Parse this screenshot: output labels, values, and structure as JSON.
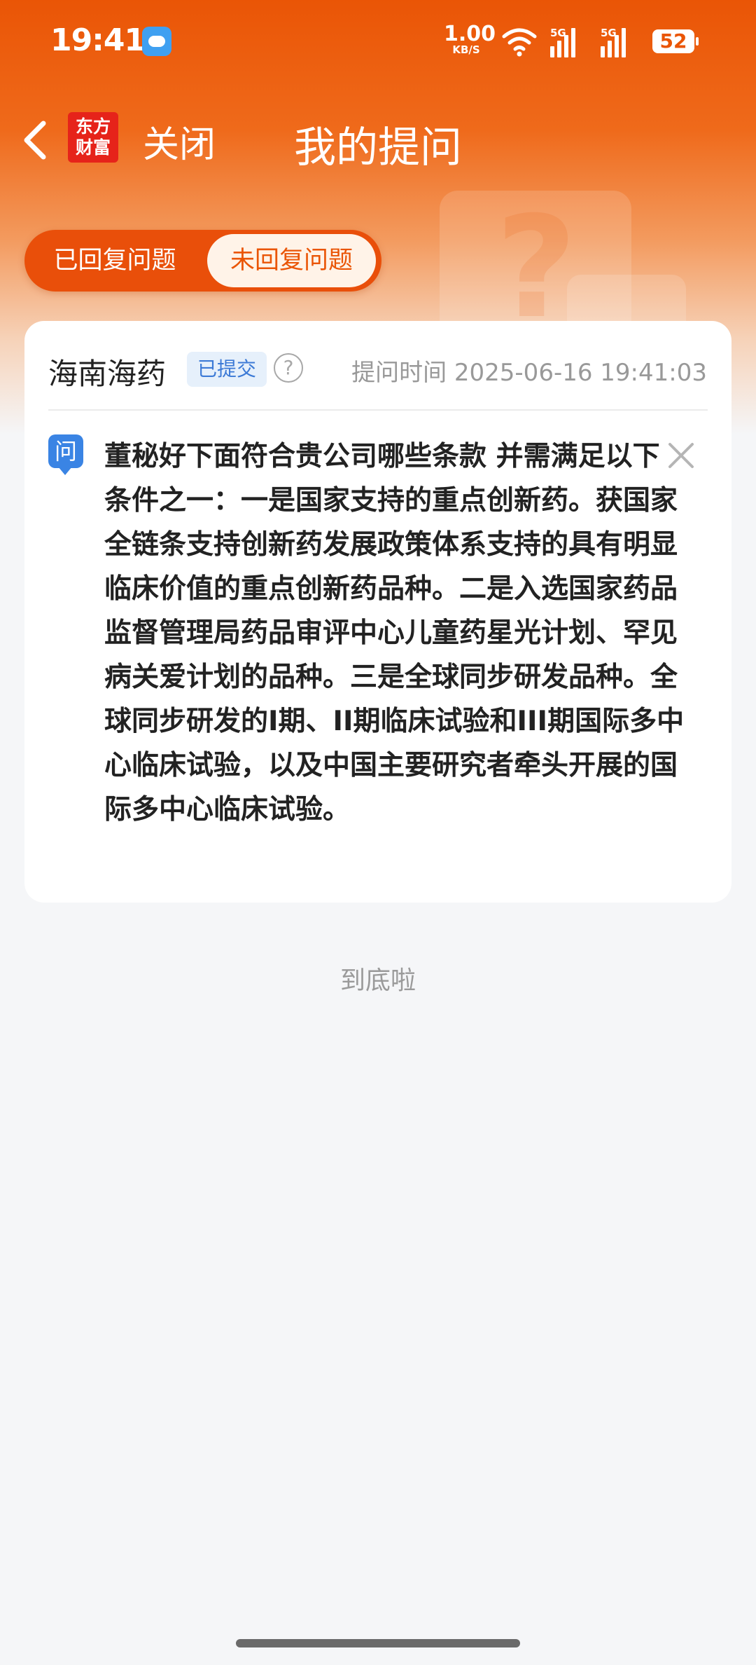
{
  "status_bar": {
    "time": "19:41",
    "net_speed_value": "1.00",
    "net_speed_unit": "KB/S",
    "signal_1_label": "5G",
    "signal_2_label": "5G",
    "battery": "52",
    "icons": [
      "weather-app-icon",
      "wifi-icon",
      "signal-icon",
      "signal-icon",
      "battery-icon"
    ]
  },
  "nav": {
    "logo_line1": "东方",
    "logo_line2": "财富",
    "close_label": "关闭",
    "title": "我的提问"
  },
  "tabs": {
    "answered": "已回复问题",
    "unanswered": "未回复问题",
    "active": "unanswered"
  },
  "question_card": {
    "company": "海南海药",
    "status": "已提交",
    "ask_time": "提问时间 2025-06-16 19:41:03",
    "q_icon_label": "问",
    "question": "董秘好下面符合贵公司哪些条款 并需满足以下条件之一：一是国家支持的重点创新药。获国家全链条支持创新药发展政策体系支持的具有明显临床价值的重点创新药品种。二是入选国家药品监督管理局药品审评中心儿童药星光计划、罕见病关爱计划的品种。三是全球同步研发品种。全球同步研发的I期、II期临床试验和III期国际多中心临床试验，以及中国主要研究者牵头开展的国际多中心临床试验。"
  },
  "footer": {
    "end_tip": "到底啦"
  },
  "colors": {
    "brand_orange": "#ea5506",
    "badge_blue": "#3c7ad6",
    "question_icon_blue": "#3a84e4"
  }
}
